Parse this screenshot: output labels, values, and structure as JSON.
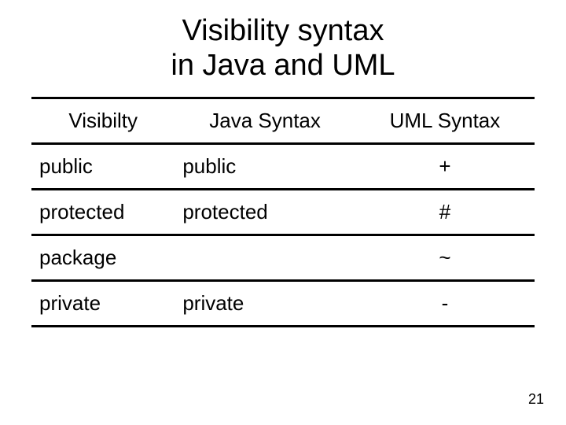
{
  "title_line1": "Visibility syntax",
  "title_line2": "in Java and UML",
  "headers": {
    "visibility": "Visibilty",
    "java": "Java Syntax",
    "uml": "UML Syntax"
  },
  "rows": [
    {
      "visibility": "public",
      "java": "public",
      "uml": "+"
    },
    {
      "visibility": "protected",
      "java": "protected",
      "uml": "#"
    },
    {
      "visibility": "package",
      "java": "",
      "uml": "~"
    },
    {
      "visibility": "private",
      "java": "private",
      "uml": "-"
    }
  ],
  "page_number": "21",
  "chart_data": {
    "type": "table",
    "title": "Visibility syntax in Java and UML",
    "columns": [
      "Visibilty",
      "Java Syntax",
      "UML Syntax"
    ],
    "rows": [
      [
        "public",
        "public",
        "+"
      ],
      [
        "protected",
        "protected",
        "#"
      ],
      [
        "package",
        "",
        "~"
      ],
      [
        "private",
        "private",
        "-"
      ]
    ]
  }
}
